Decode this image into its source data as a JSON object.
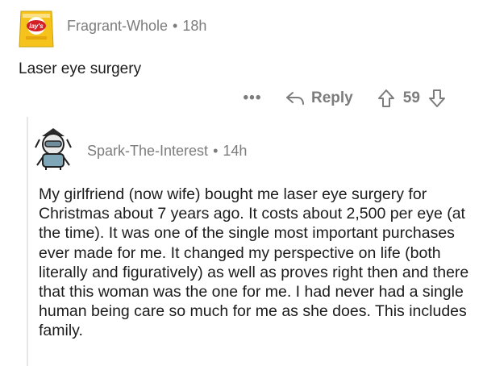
{
  "comment": {
    "author": "Fragrant-Whole",
    "separator": "•",
    "age": "18h",
    "text": "Laser eye surgery",
    "actions": {
      "more_label": "•••",
      "reply_label": "Reply",
      "score": "59"
    }
  },
  "reply_comment": {
    "author": "Spark-The-Interest",
    "separator": "•",
    "age": "14h",
    "text": "My girlfriend (now wife) bought me laser eye surgery for Christmas about 7 years ago. It costs about 2,500 per eye (at the time). It was one of the single most important purchases ever made for me. It changed my perspective on life (both literally and figuratively) as well as proves right then and there that this woman was the one for me. I had never had a single human being care so much for me as she does. This includes family."
  },
  "icons": {
    "avatar1": "lays-chip-bag-avatar",
    "avatar2": "snoo-avatar",
    "reply": "reply-arrow-icon",
    "upvote": "upvote-arrow-icon",
    "downvote": "downvote-arrow-icon",
    "more": "more-dots-icon"
  },
  "colors": {
    "meta_gray": "#7c7c7c",
    "text": "#1c1c1c",
    "thread_line": "#e6e6e6",
    "lays_yellow": "#f6c21c",
    "lays_red": "#d41f26"
  }
}
